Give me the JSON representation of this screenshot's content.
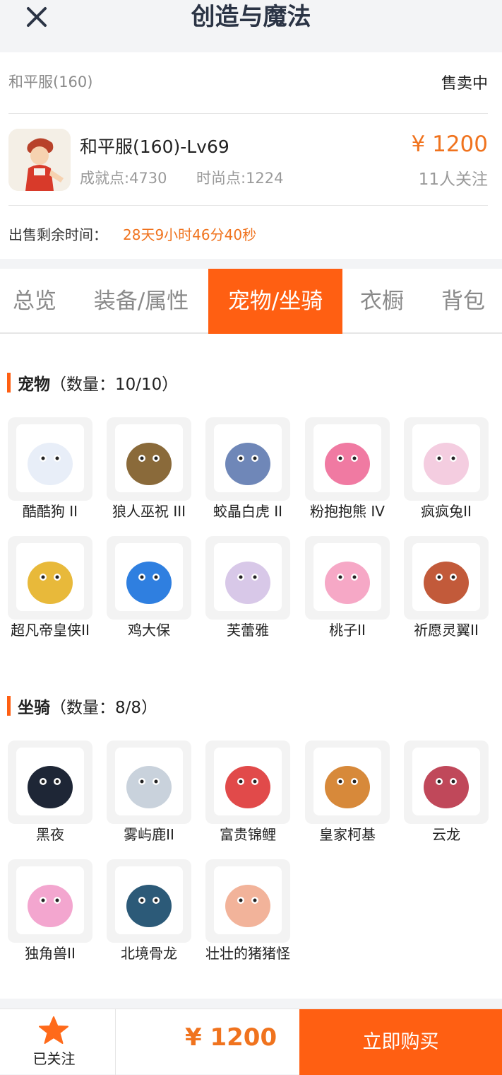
{
  "header": {
    "title": "创造与魔法"
  },
  "listing": {
    "server": "和平服(160)",
    "status": "售卖中",
    "character_name": "和平服(160)-Lv69",
    "achievement": "成就点:4730",
    "fashion": "时尚点:1224",
    "price": "¥ 1200",
    "followers": "11人关注",
    "remain_label": "出售剩余时间：",
    "remain_value": "28天9小时46分40秒"
  },
  "tabs": [
    "总览",
    "装备/属性",
    "宠物/坐骑",
    "衣橱",
    "背包"
  ],
  "active_tab": "宠物/坐骑",
  "pets": {
    "title": "宠物",
    "count": "（数量：10/10）",
    "items": [
      {
        "name": "酷酷狗 II",
        "color": "#e8eef8"
      },
      {
        "name": "狼人巫祝 III",
        "color": "#8a6a3a"
      },
      {
        "name": "蛟晶白虎 II",
        "color": "#6f87b8"
      },
      {
        "name": "粉抱抱熊 IV",
        "color": "#f07aa2"
      },
      {
        "name": "疯疯兔II",
        "color": "#f4cde0"
      },
      {
        "name": "超凡帝皇侠II",
        "color": "#e8b93a"
      },
      {
        "name": "鸡大保",
        "color": "#2f7fe0"
      },
      {
        "name": "芙蕾雅",
        "color": "#d8c8e8"
      },
      {
        "name": "桃子II",
        "color": "#f6a8c6"
      },
      {
        "name": "祈愿灵翼II",
        "color": "#c25a3a"
      }
    ]
  },
  "mounts": {
    "title": "坐骑",
    "count": "（数量：8/8）",
    "items": [
      {
        "name": "黑夜",
        "color": "#1e2636"
      },
      {
        "name": "雾屿鹿II",
        "color": "#c9d2dc"
      },
      {
        "name": "富贵锦鲤",
        "color": "#e14a4a"
      },
      {
        "name": "皇家柯基",
        "color": "#d7893a"
      },
      {
        "name": "云龙",
        "color": "#c0485a"
      },
      {
        "name": "独角兽II",
        "color": "#f3a6cf"
      },
      {
        "name": "北境骨龙",
        "color": "#2c5a78"
      },
      {
        "name": "壮壮的猪猪怪",
        "color": "#f2b39a"
      }
    ]
  },
  "bottom": {
    "follow_label": "已关注",
    "price": "¥ 1200",
    "buy_label": "立即购买"
  }
}
